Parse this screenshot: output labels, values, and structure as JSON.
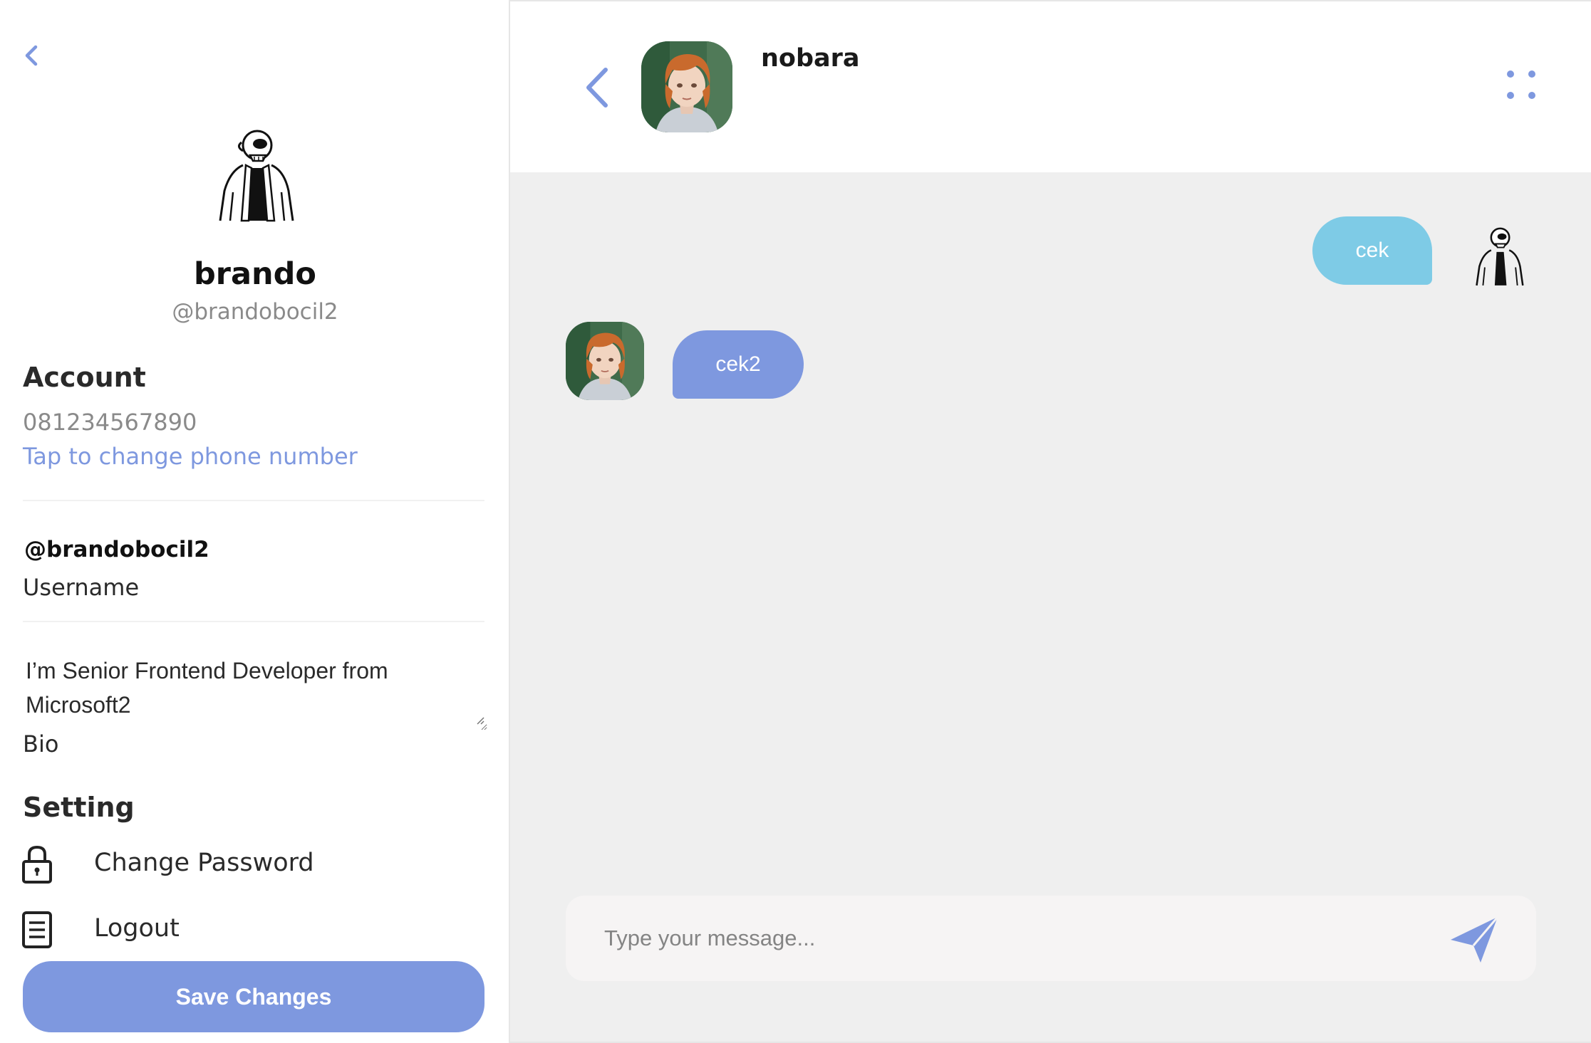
{
  "profile": {
    "name": "brando",
    "handle": "@brandobocil2",
    "avatar_icon": "cartoon-man-avatar-icon"
  },
  "account": {
    "title": "Account",
    "phone": "081234567890",
    "change_phone": "Tap to change phone number"
  },
  "username": {
    "value": "@brandobocil2",
    "label": "Username"
  },
  "bio": {
    "value": "I’m Senior Frontend Developer from Microsoft2",
    "label": "Bio"
  },
  "setting": {
    "title": "Setting",
    "items": [
      {
        "label": "Change Password",
        "icon": "lock-icon"
      },
      {
        "label": "Logout",
        "icon": "document-icon"
      }
    ]
  },
  "save_button": "Save Changes",
  "chat": {
    "contact_name": "nobara",
    "messages": [
      {
        "from": "me",
        "text": "cek"
      },
      {
        "from": "contact",
        "text": "cek2"
      }
    ],
    "input_placeholder": "Type your message..."
  },
  "colors": {
    "accent": "#7e98df",
    "sent_bubble": "#7ecbe6",
    "chat_bg": "#efefef",
    "composer_bg": "#f6f4f4"
  }
}
